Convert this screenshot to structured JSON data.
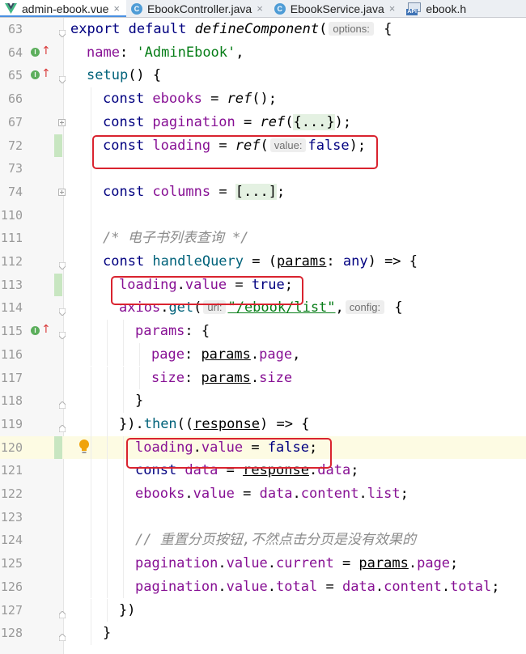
{
  "tabs": [
    {
      "label": "admin-ebook.vue",
      "icon": "vue-icon",
      "active": true,
      "closable": true
    },
    {
      "label": "EbookController.java",
      "icon": "class-icon",
      "active": false,
      "closable": true
    },
    {
      "label": "EbookService.java",
      "icon": "class-icon",
      "active": false,
      "closable": true
    },
    {
      "label": "ebook.h",
      "icon": "api-icon",
      "active": false,
      "closable": false
    }
  ],
  "class_icon_letter": "C",
  "api_icon_text": "API",
  "close_glyph": "×",
  "colors": {
    "keyword": "#000080",
    "property": "#871094",
    "function": "#00627a",
    "string": "#067d17",
    "comment": "#8c8c8c",
    "highlight_box": "#d9232f",
    "current_line": "#fdfbe3"
  },
  "line_numbers": [
    "63",
    "64",
    "65",
    "66",
    "67",
    "72",
    "73",
    "74",
    "110",
    "111",
    "112",
    "113",
    "114",
    "115",
    "116",
    "117",
    "118",
    "119",
    "120",
    "121",
    "122",
    "123",
    "124",
    "125",
    "126",
    "127",
    "128"
  ],
  "code": {
    "l63": {
      "export": "export",
      "default": "default",
      "fn": "defineComponent",
      "open": "(",
      "hint": "options:",
      "rest": " {"
    },
    "l64": {
      "key": "name",
      "sep": ": ",
      "val": "'AdminEbook'",
      "end": ","
    },
    "l65": {
      "fn": "setup",
      "rest": "() {"
    },
    "l66": {
      "kw": "const",
      "var": " ebooks",
      "eq": " = ",
      "fn": "ref",
      "rest": "();"
    },
    "l67": {
      "kw": "const",
      "var": " pagination",
      "eq": " = ",
      "fn": "ref",
      "open": "(",
      "folded": "{...}",
      "rest": ");"
    },
    "l72": {
      "kw": "const",
      "var": " loading",
      "eq": " = ",
      "fn": "ref",
      "open": "(",
      "hint": "value:",
      "val": "false",
      "rest": ");"
    },
    "l74": {
      "kw": "const",
      "var": " columns",
      "eq": " = ",
      "folded": "[...]",
      "rest": ";"
    },
    "l111": {
      "comment": "/* 电子书列表查询 */"
    },
    "l112": {
      "kw": "const",
      "fn": " handleQuery",
      "eq": " = (",
      "param": "params",
      "colon": ": ",
      "type": "any",
      "rest": ") => {"
    },
    "l113": {
      "obj": "loading",
      "dot": ".",
      "prop": "value",
      "eq": " = ",
      "val": "true",
      "end": ";"
    },
    "l114": {
      "obj": "axios",
      "dot": ".",
      "fn": "get",
      "open": "(",
      "hint1": "url:",
      "str": "\"/ebook/list\"",
      "comma": ",",
      "hint2": "config:",
      "rest": " {"
    },
    "l115": {
      "key": "params",
      "rest": ": {"
    },
    "l116": {
      "key": "page",
      "sep": ": ",
      "obj": "params",
      "dot": ".",
      "prop": "page",
      "end": ","
    },
    "l117": {
      "key": "size",
      "sep": ": ",
      "obj": "params",
      "dot": ".",
      "prop": "size"
    },
    "l118": {
      "text": "}"
    },
    "l119": {
      "pre": "}).",
      "fn": "then",
      "open": "((",
      "param": "response",
      "rest": ") => {"
    },
    "l120": {
      "obj": "loading",
      "dot": ".",
      "prop": "value",
      "eq": " = ",
      "val": "false",
      "end": ";"
    },
    "l121": {
      "kw": "const",
      "var": " data",
      "eq": " = ",
      "obj": "response",
      "dot": ".",
      "prop": "data",
      "end": ";"
    },
    "l122": {
      "obj": "ebooks",
      "dot": ".",
      "prop": "value",
      "eq": " = ",
      "obj2": "data",
      "dot2": ".",
      "prop2": "content",
      "dot3": ".",
      "prop3": "list",
      "end": ";"
    },
    "l124": {
      "comment": "// 重置分页按钮,不然点击分页是没有效果的"
    },
    "l125": {
      "obj": "pagination",
      "dot": ".",
      "prop": "value",
      "dot2": ".",
      "prop2": "current",
      "eq": " = ",
      "obj2": "params",
      "dot3": ".",
      "prop3": "page",
      "end": ";"
    },
    "l126": {
      "obj": "pagination",
      "dot": ".",
      "prop": "value",
      "dot2": ".",
      "prop2": "total",
      "eq": " = ",
      "obj2": "data",
      "dot3": ".",
      "prop3": "content",
      "dot4": ".",
      "prop4": "total",
      "end": ";"
    },
    "l127": {
      "text": "})"
    },
    "l128": {
      "text": "}"
    }
  },
  "gutter_icons": {
    "implements": "I",
    "overrides_arrow": "↑"
  }
}
